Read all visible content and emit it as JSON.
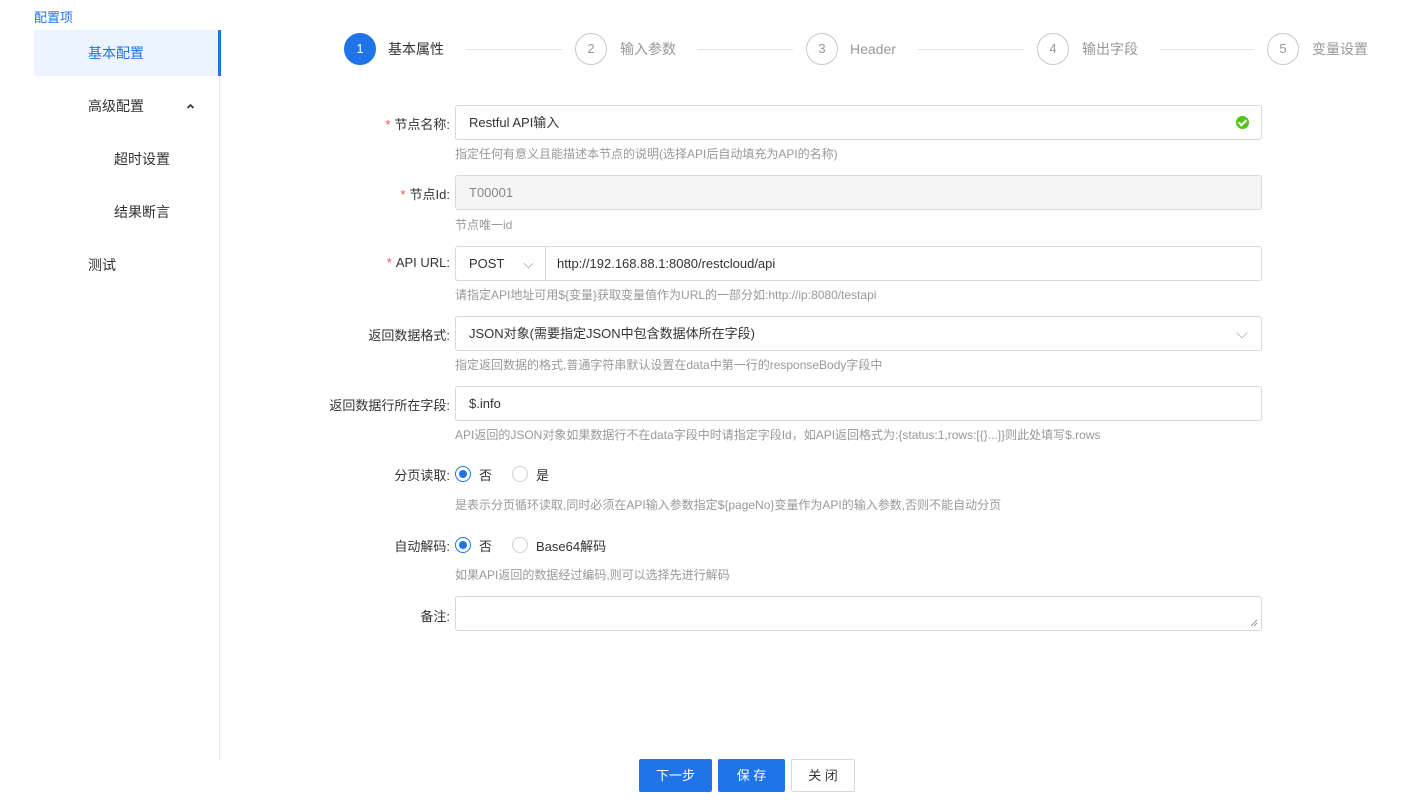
{
  "sidebar": {
    "title": "配置项",
    "items": [
      {
        "label": "基本配置"
      },
      {
        "label": "高级配置"
      },
      {
        "label": "超时设置"
      },
      {
        "label": "结果断言"
      },
      {
        "label": "测试"
      }
    ]
  },
  "steps": [
    {
      "num": "1",
      "label": "基本属性",
      "active": true
    },
    {
      "num": "2",
      "label": "输入参数"
    },
    {
      "num": "3",
      "label": "Header"
    },
    {
      "num": "4",
      "label": "输出字段"
    },
    {
      "num": "5",
      "label": "变量设置"
    }
  ],
  "form": {
    "node_name": {
      "label": "节点名称:",
      "value": "Restful API输入",
      "hint": "指定任何有意义且能描述本节点的说明(选择API后自动填充为API的名称)"
    },
    "node_id": {
      "label": "节点Id:",
      "value": "T00001",
      "hint": "节点唯一id"
    },
    "api_url": {
      "label": "API URL:",
      "method": "POST",
      "value": "http://192.168.88.1:8080/restcloud/api",
      "hint": "请指定API地址可用${变量}获取变量值作为URL的一部分如:http://ip:8080/testapi"
    },
    "return_format": {
      "label": "返回数据格式:",
      "value": "JSON对象(需要指定JSON中包含数据体所在字段)",
      "hint": "指定返回数据的格式,普通字符串默认设置在data中第一行的responseBody字段中"
    },
    "data_field": {
      "label": "返回数据行所在字段:",
      "value": "$.info",
      "hint": "API返回的JSON对象如果数据行不在data字段中时请指定字段Id，如API返回格式为:{status:1,rows:[{}...]}则此处填写$.rows"
    },
    "paging": {
      "label": "分页读取:",
      "options": [
        "否",
        "是"
      ],
      "hint": "是表示分页循环读取,同时必须在API输入参数指定${pageNo}变量作为API的输入参数,否则不能自动分页"
    },
    "decode": {
      "label": "自动解码:",
      "options": [
        "否",
        "Base64解码"
      ],
      "hint": "如果API返回的数据经过编码,则可以选择先进行解码"
    },
    "remark": {
      "label": "备注:"
    }
  },
  "buttons": {
    "next": "下一步",
    "save": "保 存",
    "close": "关 闭"
  },
  "colors": {
    "primary": "#1f74e8",
    "required": "#ff4d4f",
    "valid": "#52c41a"
  }
}
